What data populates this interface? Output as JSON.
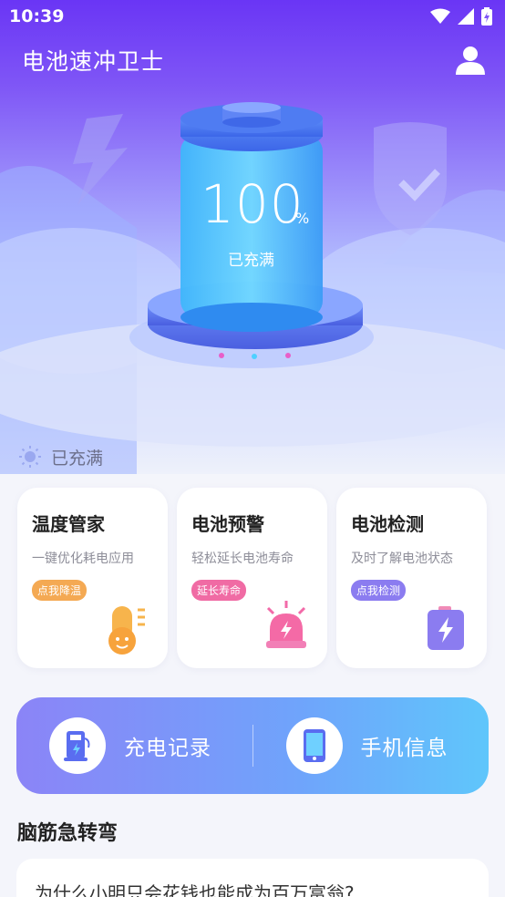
{
  "status_bar": {
    "time": "10:39"
  },
  "header": {
    "title": "电池速冲卫士",
    "user_icon": "user-icon"
  },
  "battery": {
    "percent": "100",
    "unit": "%",
    "status": "已充满",
    "level": 1.0
  },
  "section": {
    "label": "已充满",
    "icon": "sun-icon"
  },
  "features": [
    {
      "title": "温度管家",
      "desc": "一键优化耗电应用",
      "badge": "点我降温",
      "badge_color": "#f4a953",
      "icon": "thermometer-icon"
    },
    {
      "title": "电池预警",
      "desc": "轻松延长电池寿命",
      "badge": "延长寿命",
      "badge_color": "#f06ba4",
      "icon": "alarm-icon"
    },
    {
      "title": "电池检测",
      "desc": "及时了解电池状态",
      "badge": "点我检测",
      "badge_color": "#8b7cf0",
      "icon": "battery-check-icon"
    }
  ],
  "quick_actions": [
    {
      "label": "充电记录",
      "icon": "charging-pile-icon"
    },
    {
      "label": "手机信息",
      "icon": "phone-icon"
    }
  ],
  "riddle": {
    "title": "脑筋急转弯",
    "question": "为什么小明只会花钱也能成为百万富翁?"
  },
  "colors": {
    "primary": "#6a35f5",
    "accent": "#5fc6fb"
  }
}
